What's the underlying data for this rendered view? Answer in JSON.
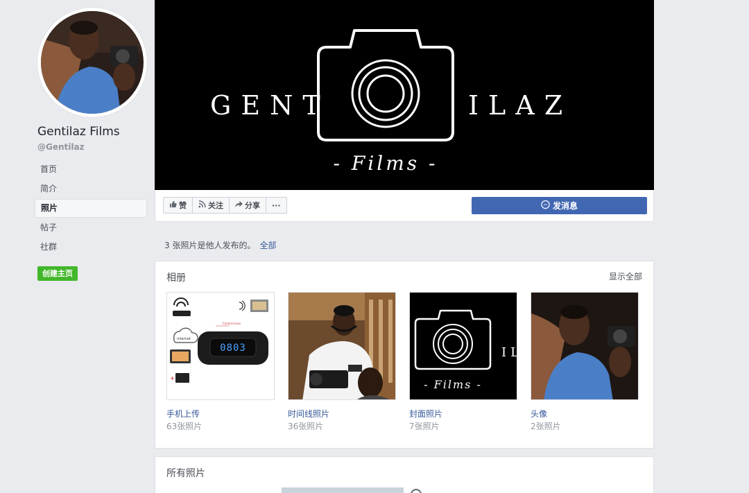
{
  "sidebar": {
    "page_name": "Gentilaz Films",
    "handle": "@Gentilaz",
    "nav": [
      {
        "label": "首页",
        "active": false
      },
      {
        "label": "简介",
        "active": false
      },
      {
        "label": "照片",
        "active": true
      },
      {
        "label": "帖子",
        "active": false
      },
      {
        "label": "社群",
        "active": false
      }
    ],
    "create_button": "创建主页"
  },
  "cover": {
    "text_left": "GENT",
    "text_right": "ILAZ",
    "subtitle": "- Films -"
  },
  "actions": {
    "like": {
      "label": "赞",
      "icon": "thumbs-up-icon"
    },
    "follow": {
      "label": "关注",
      "icon": "rss-icon"
    },
    "share": {
      "label": "分享",
      "icon": "share-arrow-icon"
    },
    "more": {
      "label": "···",
      "icon": "more-icon"
    },
    "message": {
      "label": "发消息",
      "icon": "messenger-icon"
    }
  },
  "notice": {
    "text": "3 张照片是他人发布的。",
    "link": "全部"
  },
  "albums": {
    "title": "相册",
    "see_all": "显示全部",
    "items": [
      {
        "name": "手机上传",
        "count": "63张照片",
        "thumb": "hidden-camera-clock-diagram"
      },
      {
        "name": "时间线照片",
        "count": "36张照片",
        "thumb": "man-operating-video-camera"
      },
      {
        "name": "封面照片",
        "count": "7张照片",
        "thumb": "gentilaz-films-logo"
      },
      {
        "name": "头像",
        "count": "2张照片",
        "thumb": "profile-portrait"
      }
    ],
    "clock_display": "0803"
  },
  "all_photos": {
    "title": "所有照片"
  },
  "colors": {
    "background": "#e9ebee",
    "link": "#365899",
    "primary_button": "#4267b2",
    "create_button": "#42b72a",
    "cover_background": "#000000"
  }
}
